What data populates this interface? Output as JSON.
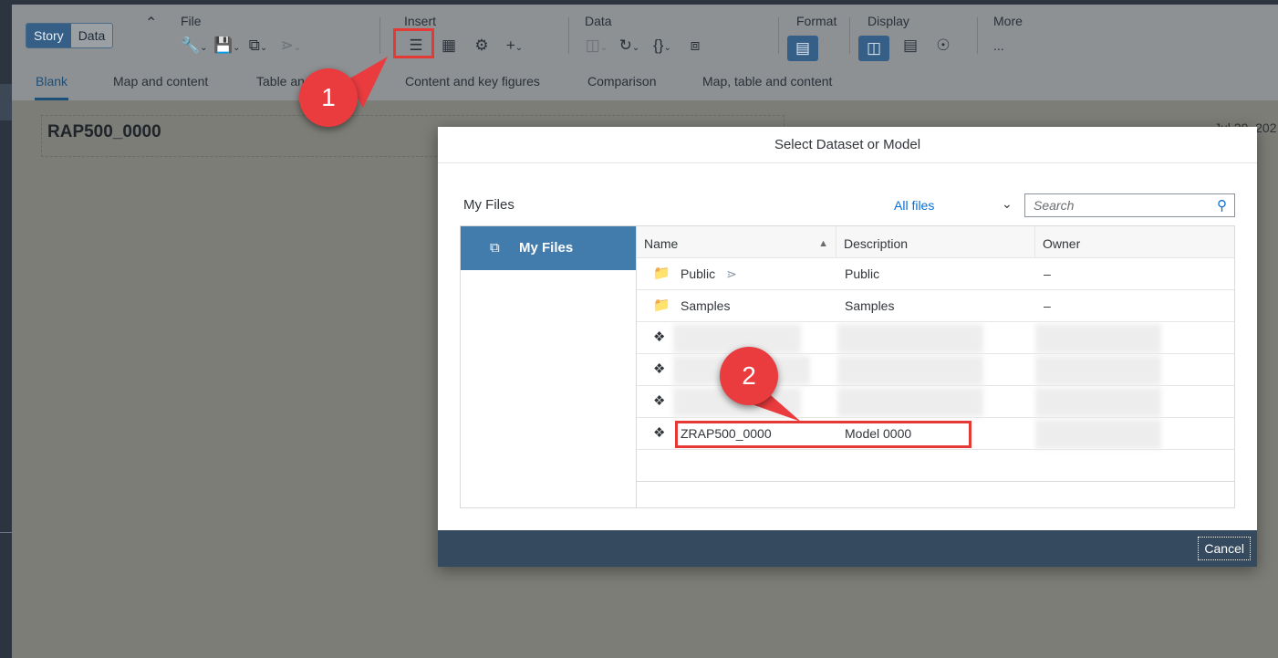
{
  "toolbar": {
    "mode_toggle": [
      "Story",
      "Data"
    ],
    "groups": {
      "file": "File",
      "insert": "Insert",
      "data": "Data",
      "format": "Format",
      "display": "Display",
      "more": "More"
    },
    "more_icon": "..."
  },
  "tabs": [
    "Blank",
    "Map and content",
    "Table and",
    "Content and key figures",
    "Comparison",
    "Map, table and content"
  ],
  "canvas": {
    "story_title": "RAP500_0000",
    "date_peek": "Jul 29, 202"
  },
  "callouts": [
    "1",
    "2"
  ],
  "modal": {
    "title": "Select Dataset or Model",
    "breadcrumb": "My Files",
    "filter": "All files",
    "search_placeholder": "Search",
    "sidebar": {
      "item": "My Files"
    },
    "columns": {
      "name": "Name",
      "description": "Description",
      "owner": "Owner"
    },
    "rows": [
      {
        "icon": "folder-icon",
        "name": "Public",
        "description": "Public",
        "owner": "–",
        "shared": true
      },
      {
        "icon": "folder-icon",
        "name": "Samples",
        "description": "Samples",
        "owner": "–"
      },
      {
        "icon": "model-icon",
        "name": "",
        "description": "",
        "owner": ""
      },
      {
        "icon": "model-icon",
        "name": "",
        "description": "",
        "owner": ""
      },
      {
        "icon": "model-icon",
        "name": "",
        "description": "",
        "owner": ""
      },
      {
        "icon": "model-icon",
        "name": "ZRAP500_0000",
        "description": "Model 0000",
        "owner": ""
      }
    ],
    "cancel": "Cancel"
  },
  "colors": {
    "accent": "#427cac",
    "footer": "#354a5f",
    "highlight": "#e53935",
    "link": "#0a6ed1"
  }
}
